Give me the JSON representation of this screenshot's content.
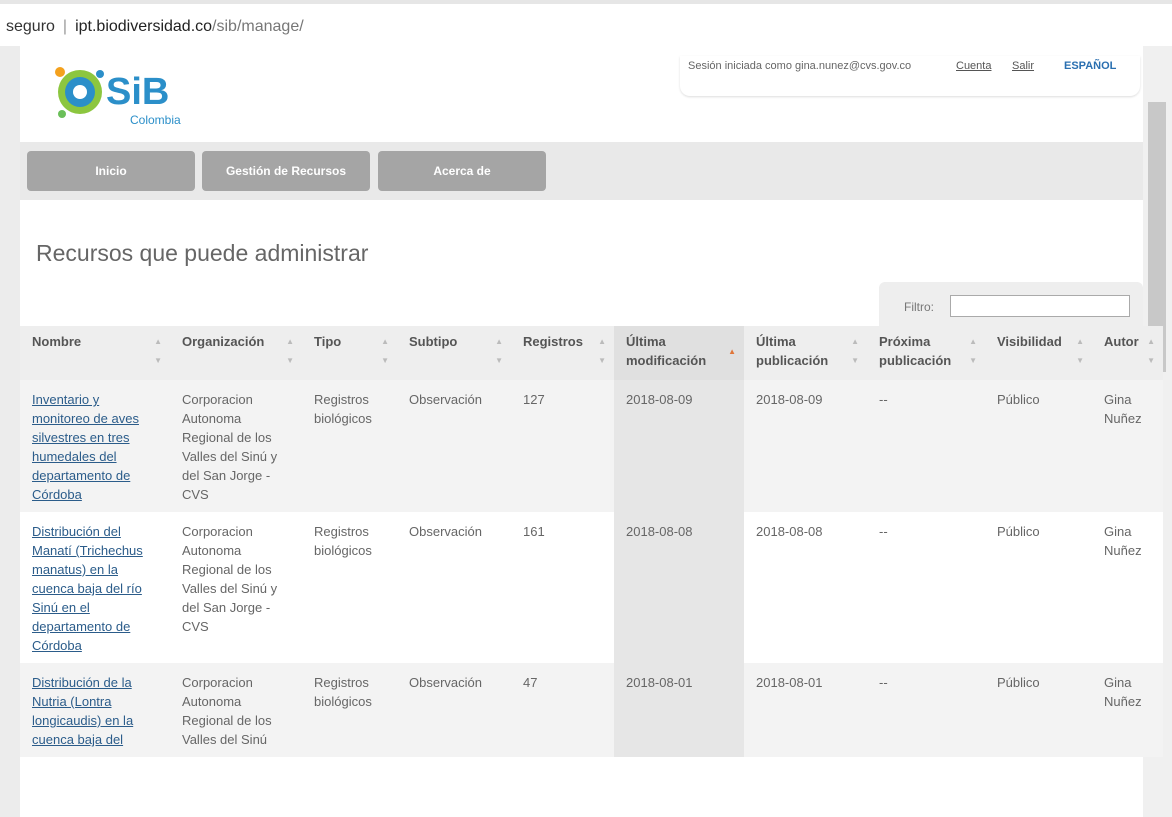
{
  "browser": {
    "security": "seguro",
    "host": "ipt.biodiversidad.co",
    "path": "/sib/manage/"
  },
  "header": {
    "logo_text": "SiB",
    "logo_sub": "Colombia",
    "session": "Sesión iniciada como gina.nunez@cvs.gov.co",
    "account": "Cuenta",
    "logout": "Salir",
    "language": "ESPAÑOL"
  },
  "nav": {
    "items": [
      {
        "label": "Inicio"
      },
      {
        "label": "Gestión de Recursos"
      },
      {
        "label": "Acerca de"
      }
    ]
  },
  "page": {
    "title": "Recursos que puede administrar"
  },
  "filter": {
    "label": "Filtro:",
    "value": ""
  },
  "table": {
    "headers": [
      {
        "label": "Nombre"
      },
      {
        "label": "Organización"
      },
      {
        "label": "Tipo"
      },
      {
        "label": "Subtipo"
      },
      {
        "label": "Registros"
      },
      {
        "label": "Última modificación"
      },
      {
        "label": "Última publicación"
      },
      {
        "label": "Próxima publicación"
      },
      {
        "label": "Visibilidad"
      },
      {
        "label": "Autor"
      }
    ],
    "rows": [
      {
        "nombre": "Inventario y monitoreo de aves silvestres en tres humedales del departamento de Córdoba",
        "organizacion": "Corporacion Autonoma Regional de los Valles del Sinú y del San Jorge - CVS",
        "tipo": "Registros biológicos",
        "subtipo": "Observación",
        "registros": "127",
        "modificacion": "2018-08-09",
        "publicacion": "2018-08-09",
        "proxima": "--",
        "visibilidad": "Público",
        "autor": "Gina Nuñez"
      },
      {
        "nombre": "Distribución del Manatí (Trichechus manatus) en la cuenca baja del río Sinú en el departamento de Córdoba",
        "organizacion": "Corporacion Autonoma Regional de los Valles del Sinú y del San Jorge - CVS",
        "tipo": "Registros biológicos",
        "subtipo": "Observación",
        "registros": "161",
        "modificacion": "2018-08-08",
        "publicacion": "2018-08-08",
        "proxima": "--",
        "visibilidad": "Público",
        "autor": "Gina Nuñez"
      },
      {
        "nombre": "Distribución de la Nutria (Lontra longicaudis) en la cuenca baja del",
        "organizacion": "Corporacion Autonoma Regional de los Valles del Sinú",
        "tipo": "Registros biológicos",
        "subtipo": "Observación",
        "registros": "47",
        "modificacion": "2018-08-01",
        "publicacion": "2018-08-01",
        "proxima": "--",
        "visibilidad": "Público",
        "autor": "Gina Nuñez"
      }
    ]
  },
  "colors": {
    "nav_button": "#a5a5a5",
    "link": "#2b5c8a",
    "language": "#2a6fb0",
    "sort_active": "#e0763a"
  }
}
